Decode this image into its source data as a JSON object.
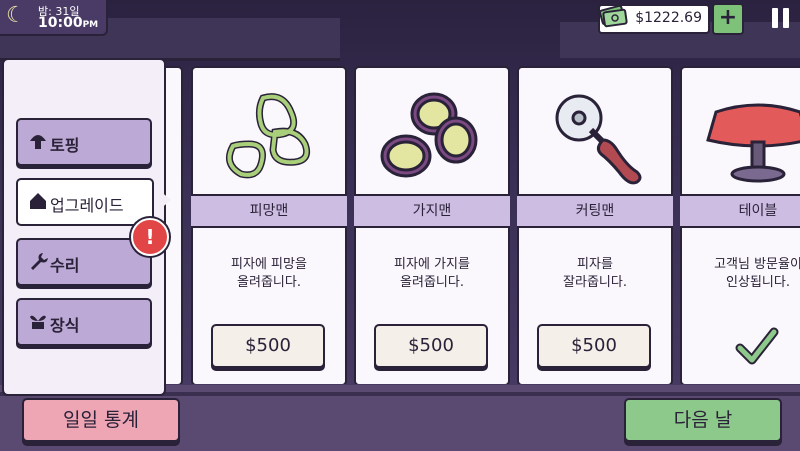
{
  "hud": {
    "day_label": "밤: 31일",
    "time": "10:00",
    "time_suffix": "PM",
    "money": "$1222.69",
    "add_label": "+"
  },
  "tabs": [
    {
      "label": "토핑",
      "icon": "mushroom-icon"
    },
    {
      "label": "업그레이드",
      "icon": "house-icon",
      "active": true
    },
    {
      "label": "수리",
      "icon": "wrench-icon"
    },
    {
      "label": "장식",
      "icon": "plant-icon"
    }
  ],
  "alert_symbol": "!",
  "items": [
    {
      "name": "피망맨",
      "desc": "피자에 피망을\n올려줍니다.",
      "price": "$500",
      "icon": "green-pepper-icon"
    },
    {
      "name": "가지맨",
      "desc": "피자에 가지를\n올려줍니다.",
      "price": "$500",
      "icon": "eggplant-icon"
    },
    {
      "name": "커팅맨",
      "desc": "피자를\n잘라줍니다.",
      "price": "$500",
      "icon": "pizza-cutter-icon"
    },
    {
      "name": "테이블",
      "desc": "고객님 방문율이\n인상됩니다.",
      "owned": true,
      "icon": "table-icon"
    }
  ],
  "buttons": {
    "stats": "일일 통계",
    "next": "다음 날"
  },
  "colors": {
    "outline": "#2a2238",
    "tab": "#bda9d6",
    "name_bar": "#cdbde2",
    "stats_button": "#eea5b4",
    "next_button": "#8dc98a",
    "alert": "#e24545"
  }
}
